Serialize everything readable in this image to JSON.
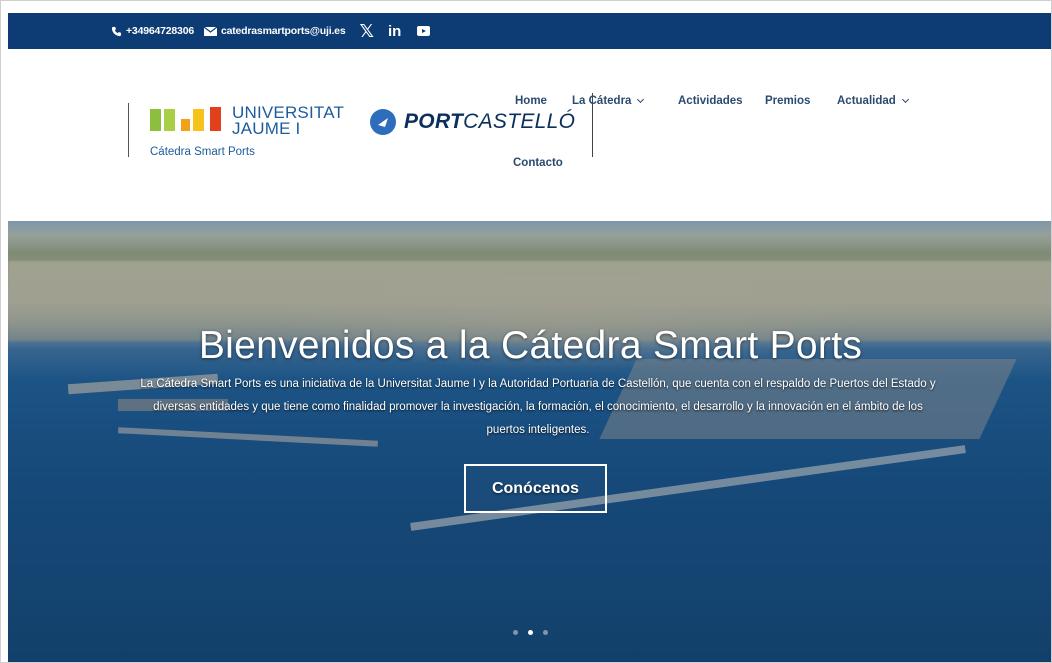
{
  "topbar": {
    "phone": "+34964728306",
    "email": "catedrasmartports@uji.es",
    "social": [
      "x-icon",
      "linkedin-icon",
      "youtube-icon"
    ],
    "linkedin_label": "in",
    "x_label": "𝕏"
  },
  "logos": {
    "uji_name": "UNIVERSITAT",
    "uji_name2": "JAUME I",
    "uji_sub": "Cátedra Smart Ports",
    "port_bold": "PORT",
    "port_rest": "CASTELLÓ"
  },
  "nav": {
    "items": [
      {
        "label": "Home"
      },
      {
        "label": "La Cátedra"
      },
      {
        "label": "Actividades"
      },
      {
        "label": "Premios"
      },
      {
        "label": "Actualidad"
      },
      {
        "label": "Contacto"
      }
    ]
  },
  "hero": {
    "title": "Bienvenidos a la Cátedra Smart Ports",
    "description": "La Cátedra Smart Ports es una iniciativa de la Universitat Jaume I y la Autoridad Portuaria de Castellón, que cuenta con el respaldo de Puertos del Estado y diversas entidades y que tiene como finalidad promover la investigación, la formación, el conocimiento, el desarrollo y la innovación en el ámbito de los puertos inteligentes.",
    "button_label": "Conócenos",
    "slides": 3,
    "active_slide": 2
  },
  "colors": {
    "topbar_bg": "#0d3b73",
    "nav_text": "#2b4a6f",
    "uji_blue": "#1d5c9b"
  }
}
